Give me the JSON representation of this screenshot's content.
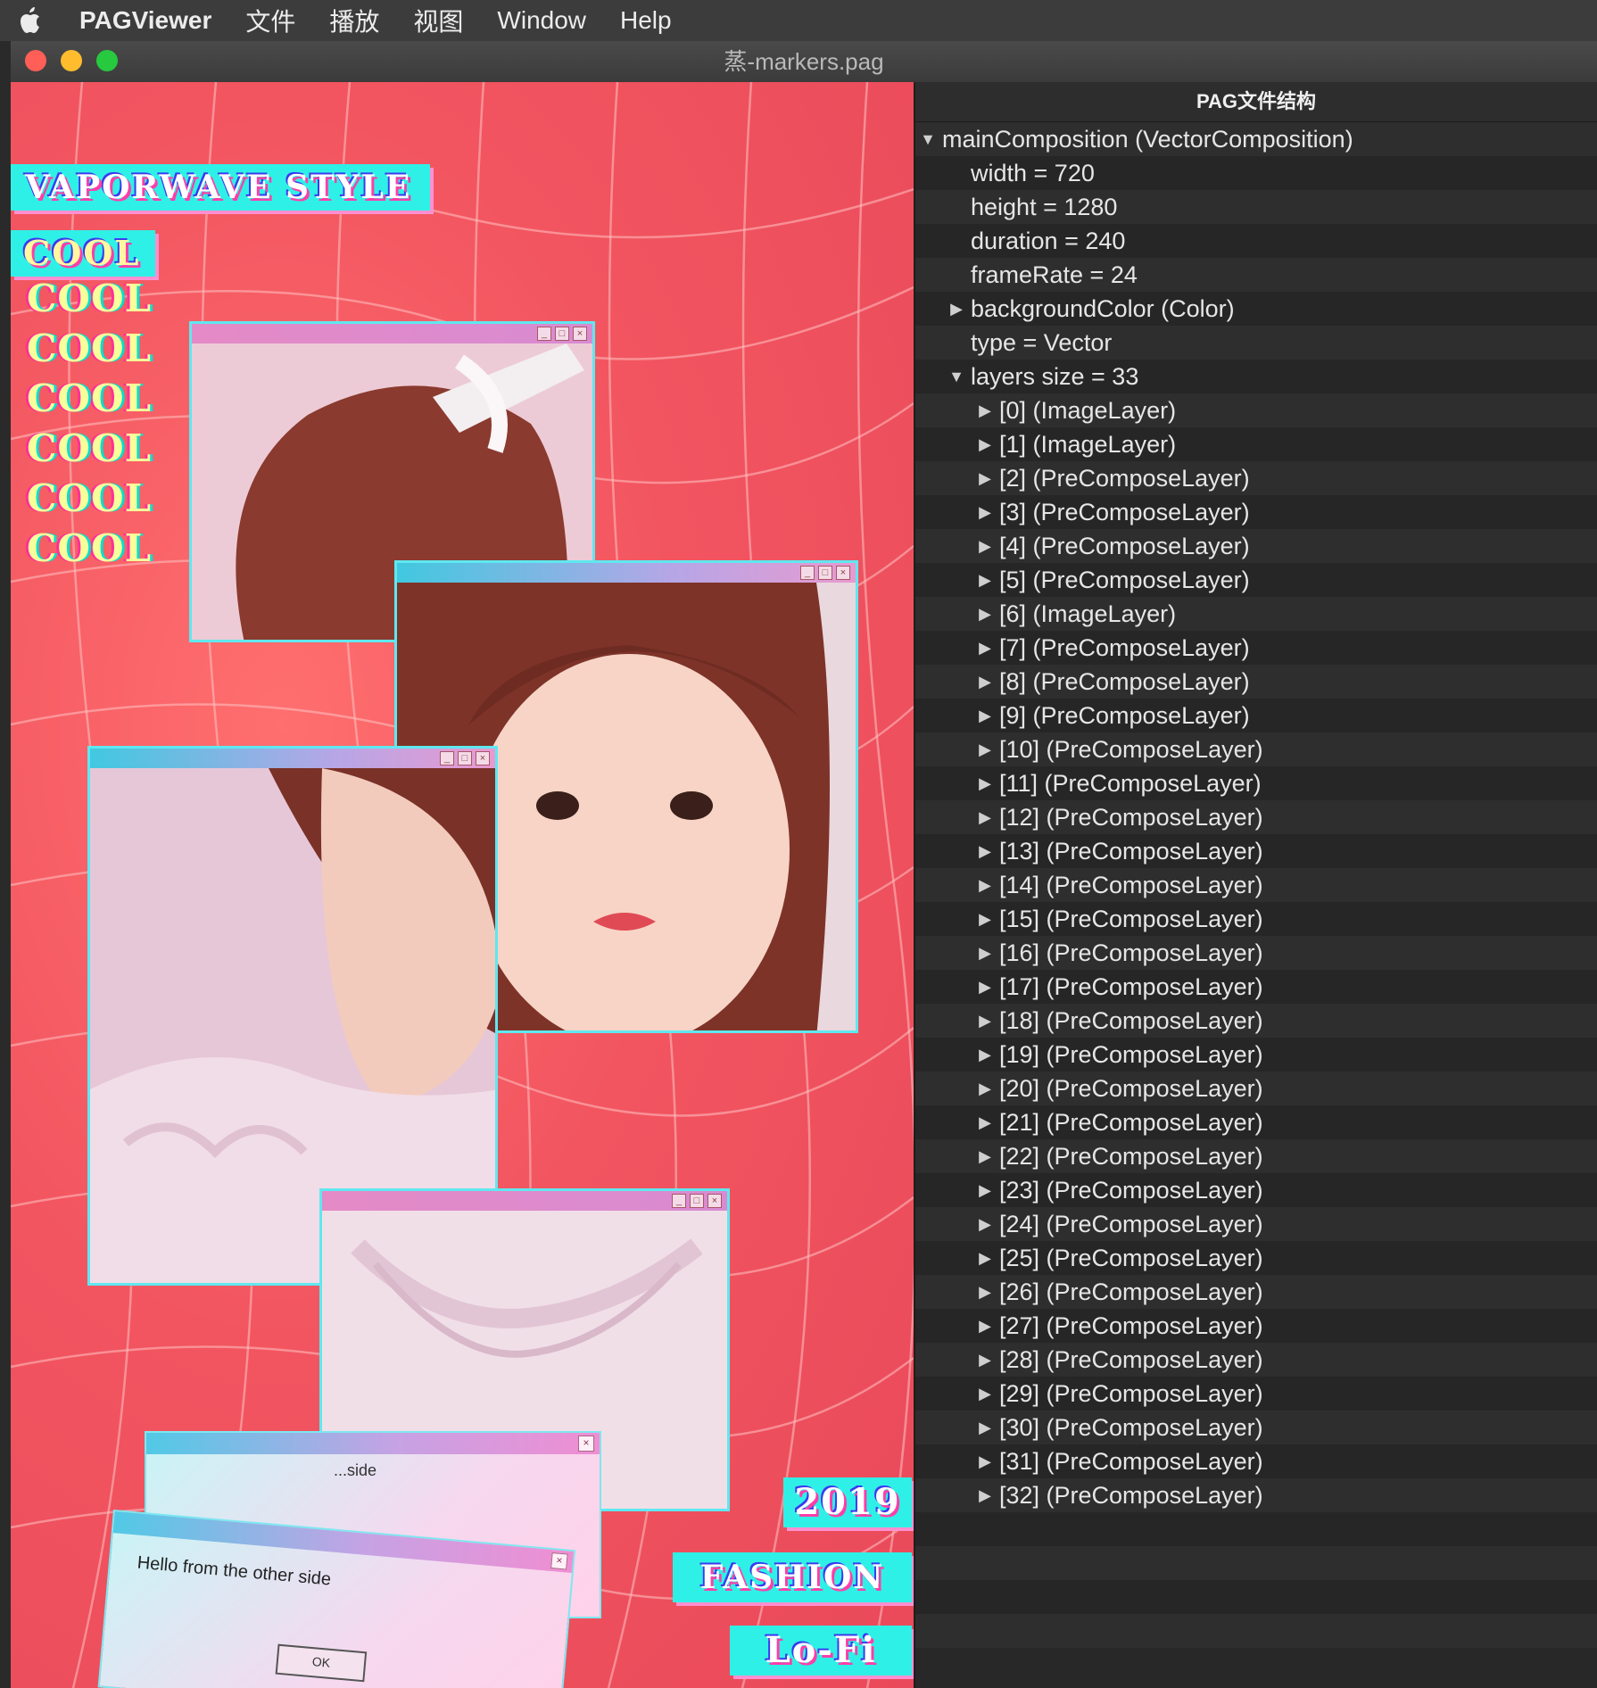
{
  "menubar": {
    "apple_icon": "apple-icon",
    "items": [
      "PAGViewer",
      "文件",
      "播放",
      "视图",
      "Window",
      "Help"
    ]
  },
  "window": {
    "title": "蒸-markers.pag",
    "traffic_lights": {
      "close": "#ff5f56",
      "minimize": "#ffbd2e",
      "zoom": "#27c93f"
    }
  },
  "preview": {
    "header_tag": "VAPORWAVE STYLE",
    "cool_labels": [
      "COOL",
      "COOL",
      "COOL",
      "COOL",
      "COOL",
      "COOL",
      "COOL"
    ],
    "dialog_text": "Hello from the other side",
    "dialog_back_text": "...side",
    "dialog_ok": "OK",
    "tag_year": "2019",
    "tag_fashion": "FASHION",
    "tag_lofi": "Lo-Fi",
    "colors": {
      "background": "#ef5261",
      "accent_cyan": "#2ff0e6",
      "accent_pink": "#ff3ea8"
    }
  },
  "panel": {
    "header": "PAG文件结构",
    "rows": [
      {
        "depth": 0,
        "arrow": "expanded",
        "label": "mainComposition (VectorComposition)"
      },
      {
        "depth": 1,
        "arrow": "none",
        "label": "width = 720"
      },
      {
        "depth": 1,
        "arrow": "none",
        "label": "height = 1280"
      },
      {
        "depth": 1,
        "arrow": "none",
        "label": "duration = 240"
      },
      {
        "depth": 1,
        "arrow": "none",
        "label": "frameRate = 24"
      },
      {
        "depth": 1,
        "arrow": "collapsed",
        "label": "backgroundColor (Color)"
      },
      {
        "depth": 1,
        "arrow": "none",
        "label": "type = Vector"
      },
      {
        "depth": 1,
        "arrow": "expanded",
        "label": "layers size = 33"
      },
      {
        "depth": 2,
        "arrow": "collapsed",
        "label": "[0] (ImageLayer)"
      },
      {
        "depth": 2,
        "arrow": "collapsed",
        "label": "[1] (ImageLayer)"
      },
      {
        "depth": 2,
        "arrow": "collapsed",
        "label": "[2] (PreComposeLayer)"
      },
      {
        "depth": 2,
        "arrow": "collapsed",
        "label": "[3] (PreComposeLayer)"
      },
      {
        "depth": 2,
        "arrow": "collapsed",
        "label": "[4] (PreComposeLayer)"
      },
      {
        "depth": 2,
        "arrow": "collapsed",
        "label": "[5] (PreComposeLayer)"
      },
      {
        "depth": 2,
        "arrow": "collapsed",
        "label": "[6] (ImageLayer)"
      },
      {
        "depth": 2,
        "arrow": "collapsed",
        "label": "[7] (PreComposeLayer)"
      },
      {
        "depth": 2,
        "arrow": "collapsed",
        "label": "[8] (PreComposeLayer)"
      },
      {
        "depth": 2,
        "arrow": "collapsed",
        "label": "[9] (PreComposeLayer)"
      },
      {
        "depth": 2,
        "arrow": "collapsed",
        "label": "[10] (PreComposeLayer)"
      },
      {
        "depth": 2,
        "arrow": "collapsed",
        "label": "[11] (PreComposeLayer)"
      },
      {
        "depth": 2,
        "arrow": "collapsed",
        "label": "[12] (PreComposeLayer)"
      },
      {
        "depth": 2,
        "arrow": "collapsed",
        "label": "[13] (PreComposeLayer)"
      },
      {
        "depth": 2,
        "arrow": "collapsed",
        "label": "[14] (PreComposeLayer)"
      },
      {
        "depth": 2,
        "arrow": "collapsed",
        "label": "[15] (PreComposeLayer)"
      },
      {
        "depth": 2,
        "arrow": "collapsed",
        "label": "[16] (PreComposeLayer)"
      },
      {
        "depth": 2,
        "arrow": "collapsed",
        "label": "[17] (PreComposeLayer)"
      },
      {
        "depth": 2,
        "arrow": "collapsed",
        "label": "[18] (PreComposeLayer)"
      },
      {
        "depth": 2,
        "arrow": "collapsed",
        "label": "[19] (PreComposeLayer)"
      },
      {
        "depth": 2,
        "arrow": "collapsed",
        "label": "[20] (PreComposeLayer)"
      },
      {
        "depth": 2,
        "arrow": "collapsed",
        "label": "[21] (PreComposeLayer)"
      },
      {
        "depth": 2,
        "arrow": "collapsed",
        "label": "[22] (PreComposeLayer)"
      },
      {
        "depth": 2,
        "arrow": "collapsed",
        "label": "[23] (PreComposeLayer)"
      },
      {
        "depth": 2,
        "arrow": "collapsed",
        "label": "[24] (PreComposeLayer)"
      },
      {
        "depth": 2,
        "arrow": "collapsed",
        "label": "[25] (PreComposeLayer)"
      },
      {
        "depth": 2,
        "arrow": "collapsed",
        "label": "[26] (PreComposeLayer)"
      },
      {
        "depth": 2,
        "arrow": "collapsed",
        "label": "[27] (PreComposeLayer)"
      },
      {
        "depth": 2,
        "arrow": "collapsed",
        "label": "[28] (PreComposeLayer)"
      },
      {
        "depth": 2,
        "arrow": "collapsed",
        "label": "[29] (PreComposeLayer)"
      },
      {
        "depth": 2,
        "arrow": "collapsed",
        "label": "[30] (PreComposeLayer)"
      },
      {
        "depth": 2,
        "arrow": "collapsed",
        "label": "[31] (PreComposeLayer)"
      },
      {
        "depth": 2,
        "arrow": "collapsed",
        "label": "[32] (PreComposeLayer)"
      }
    ]
  }
}
